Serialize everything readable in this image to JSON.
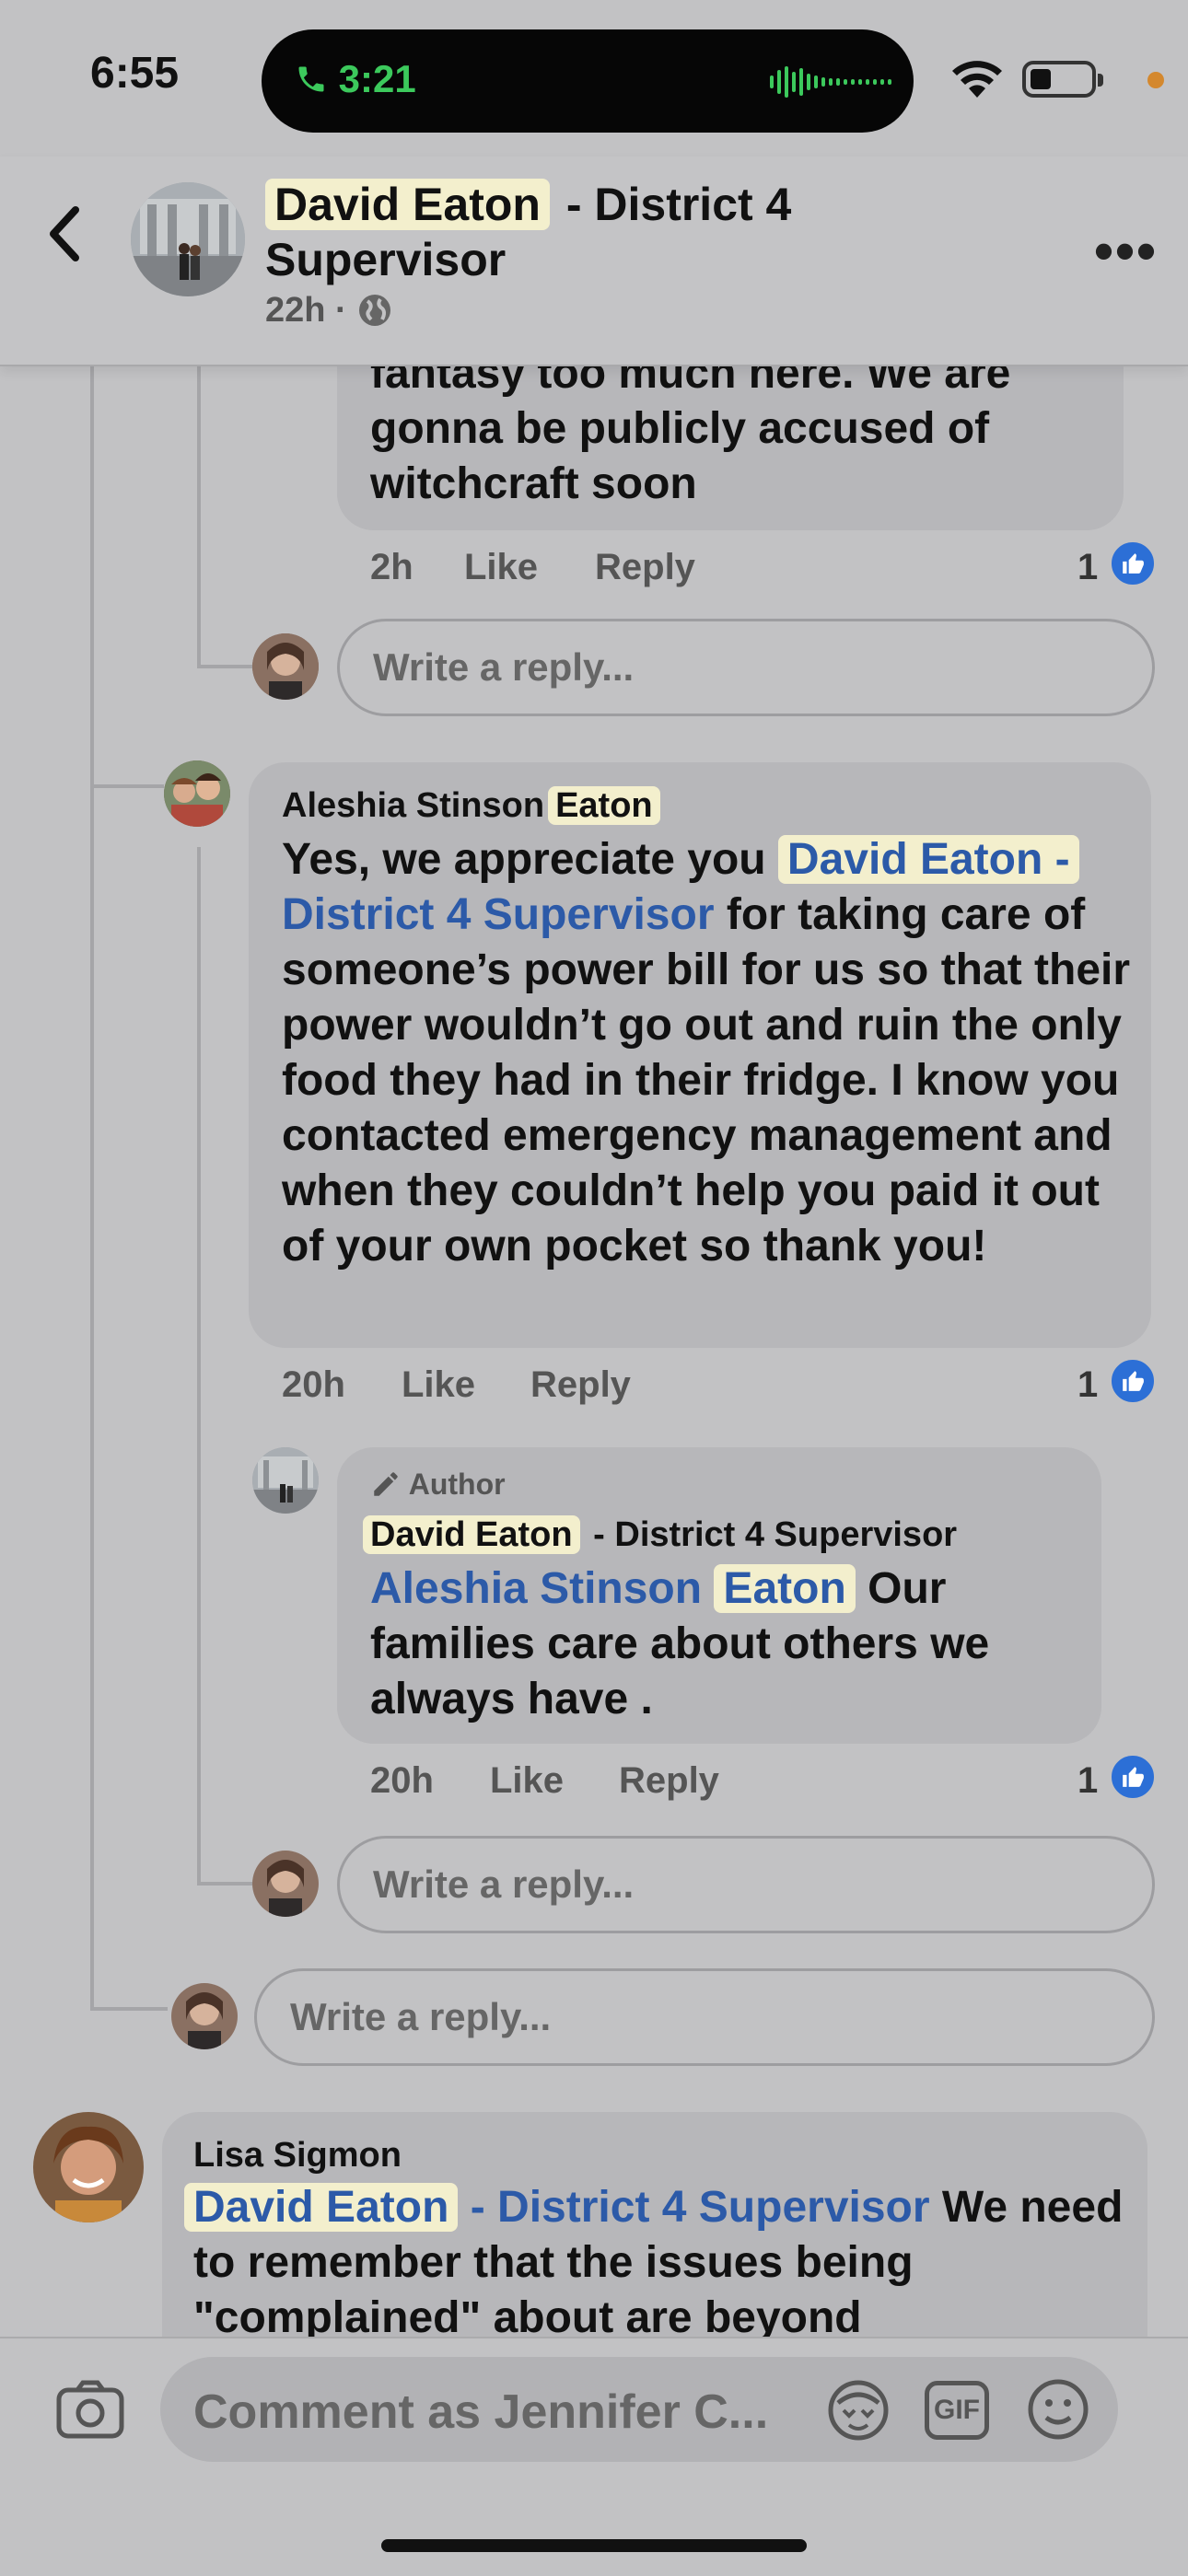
{
  "status": {
    "time": "6:55",
    "call_timer": "3:21"
  },
  "header": {
    "name_highlight": "David Eaton",
    "title_rest": " - District 4 Supervisor",
    "meta_time": "22h",
    "meta_sep": "·"
  },
  "comment1": {
    "text_partial": "fantasy too much here. We are gonna be publicly accused of witchcraft soon",
    "time": "2h",
    "like": "Like",
    "reply": "Reply",
    "likes": "1"
  },
  "reply_placeholder": "Write a reply...",
  "comment2": {
    "name_first": "Aleshia Stinson",
    "name_highlight": "Eaton",
    "text_intro": "Yes, we appreciate you ",
    "mention_highlight": "David Eaton -",
    "mention_rest": "District 4 Supervisor",
    "text_body": " for taking care of someone’s power bill for us so that their power wouldn’t go out and ruin the only food they had in their fridge. I know you contacted emergency management and when they couldn’t help you paid it out of your own pocket so thank you!",
    "time": "20h",
    "like": "Like",
    "reply": "Reply",
    "likes": "1"
  },
  "comment3": {
    "badge": "Author",
    "name_highlight": "David Eaton",
    "name_rest": " - District 4 Supervisor",
    "mention_first": "Aleshia Stinson",
    "mention_highlight": "Eaton",
    "text_body": " Our families care about others we always have .",
    "time": "20h",
    "like": "Like",
    "reply": "Reply",
    "likes": "1"
  },
  "comment4": {
    "name": "Lisa Sigmon",
    "mention_highlight": "David Eaton",
    "mention_rest": " - District 4 Supervisor",
    "text_body": " We need to remember that the issues being \"complained\" about are beyond"
  },
  "composer": {
    "placeholder": "Comment as Jennifer C...",
    "gif_label": "GIF"
  }
}
